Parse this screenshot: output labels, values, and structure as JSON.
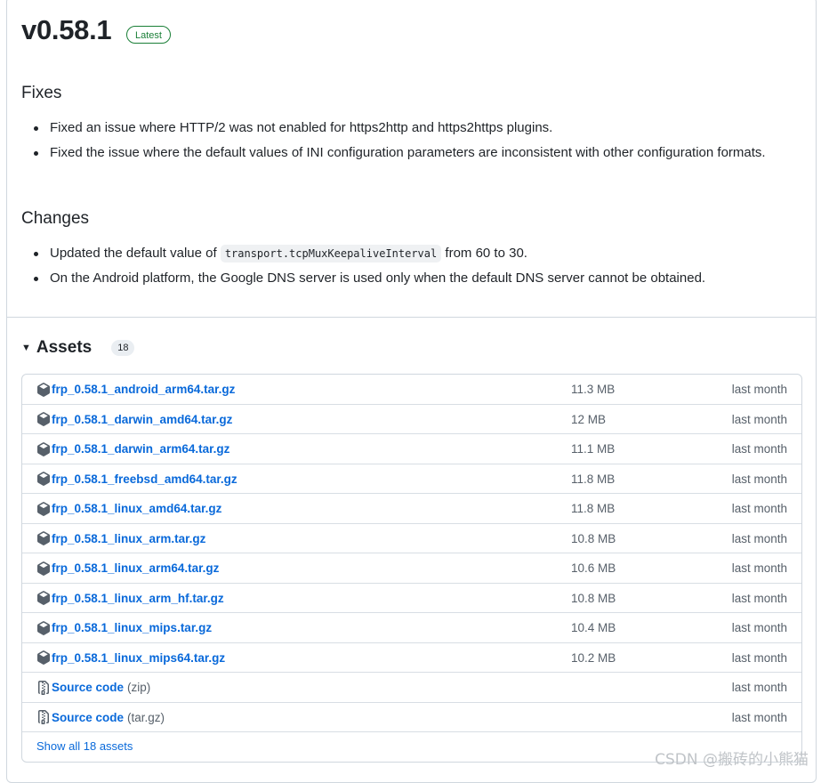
{
  "release": {
    "version": "v0.58.1",
    "badge": "Latest"
  },
  "fixes": {
    "heading": "Fixes",
    "items": [
      "Fixed an issue where HTTP/2 was not enabled for https2http and https2https plugins.",
      "Fixed the issue where the default values of INI configuration parameters are inconsistent with other configuration formats."
    ]
  },
  "changes": {
    "heading": "Changes",
    "item1_before": "Updated the default value of ",
    "item1_code": "transport.tcpMuxKeepaliveInterval",
    "item1_after": " from 60 to 30.",
    "item2": "On the Android platform, the Google DNS server is used only when the default DNS server cannot be obtained."
  },
  "assets": {
    "title": "Assets",
    "count": "18",
    "rows": [
      {
        "name": "frp_0.58.1_android_arm64.tar.gz",
        "size": "11.3 MB",
        "time": "last month"
      },
      {
        "name": "frp_0.58.1_darwin_amd64.tar.gz",
        "size": "12 MB",
        "time": "last month"
      },
      {
        "name": "frp_0.58.1_darwin_arm64.tar.gz",
        "size": "11.1 MB",
        "time": "last month"
      },
      {
        "name": "frp_0.58.1_freebsd_amd64.tar.gz",
        "size": "11.8 MB",
        "time": "last month"
      },
      {
        "name": "frp_0.58.1_linux_amd64.tar.gz",
        "size": "11.8 MB",
        "time": "last month"
      },
      {
        "name": "frp_0.58.1_linux_arm.tar.gz",
        "size": "10.8 MB",
        "time": "last month"
      },
      {
        "name": "frp_0.58.1_linux_arm64.tar.gz",
        "size": "10.6 MB",
        "time": "last month"
      },
      {
        "name": "frp_0.58.1_linux_arm_hf.tar.gz",
        "size": "10.8 MB",
        "time": "last month"
      },
      {
        "name": "frp_0.58.1_linux_mips.tar.gz",
        "size": "10.4 MB",
        "time": "last month"
      },
      {
        "name": "frp_0.58.1_linux_mips64.tar.gz",
        "size": "10.2 MB",
        "time": "last month"
      }
    ],
    "source_rows": [
      {
        "name": "Source code",
        "ext": "(zip)",
        "time": "last month"
      },
      {
        "name": "Source code",
        "ext": "(tar.gz)",
        "time": "last month"
      }
    ],
    "show_all": "Show all 18 assets"
  },
  "watermark": "CSDN @搬砖的小熊猫",
  "colors": {
    "link": "#0969da",
    "latest_badge": "#1a7f37",
    "muted": "#57606a",
    "border": "#d0d7de"
  },
  "icons": {
    "package": "package-icon",
    "zip": "file-zip-icon",
    "caret": "triangle-down-icon"
  }
}
